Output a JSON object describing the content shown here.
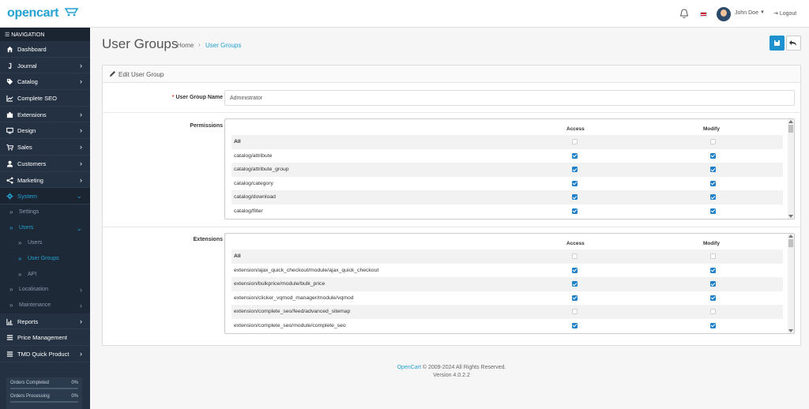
{
  "header": {
    "logo": "opencart",
    "user_name": "John Doe",
    "logout_label": "Logout"
  },
  "sidebar": {
    "nav_header": "NAVIGATION",
    "items": [
      {
        "label": "Dashboard",
        "icon": "home-icon",
        "has_children": false
      },
      {
        "label": "Journal",
        "icon": "journal-icon",
        "has_children": true
      },
      {
        "label": "Catalog",
        "icon": "tag-icon",
        "has_children": true
      },
      {
        "label": "Complete SEO",
        "icon": "chart-line-icon",
        "has_children": false
      },
      {
        "label": "Extensions",
        "icon": "puzzle-icon",
        "has_children": true
      },
      {
        "label": "Design",
        "icon": "monitor-icon",
        "has_children": true
      },
      {
        "label": "Sales",
        "icon": "cart-icon",
        "has_children": true
      },
      {
        "label": "Customers",
        "icon": "user-icon",
        "has_children": true
      },
      {
        "label": "Marketing",
        "icon": "share-icon",
        "has_children": true
      },
      {
        "label": "System",
        "icon": "gear-icon",
        "has_children": true,
        "active": true
      }
    ],
    "system_sub": {
      "settings": "Settings",
      "users": "Users",
      "users_sub": [
        "Users",
        "User Groups",
        "API"
      ],
      "localisation": "Localisation",
      "maintenance": "Maintenance"
    },
    "after_items": [
      {
        "label": "Reports",
        "icon": "bar-chart-icon",
        "has_children": true
      },
      {
        "label": "Price Management",
        "icon": "list-icon",
        "has_children": false
      },
      {
        "label": "TMD Quick Product",
        "icon": "list-icon",
        "has_children": true
      }
    ],
    "stats": [
      {
        "label": "Orders Completed",
        "pct": "0%"
      },
      {
        "label": "Orders Processing",
        "pct": "0%"
      }
    ]
  },
  "page": {
    "title": "User Groups",
    "breadcrumb_home": "Home",
    "breadcrumb_current": "User Groups"
  },
  "panel": {
    "title": "Edit User Group",
    "name_label": "User Group Name",
    "name_value": "Administrator",
    "permissions_label": "Permissions",
    "extensions_label": "Extensions",
    "col_access": "Access",
    "col_modify": "Modify",
    "all_label": "All",
    "permissions_rows": [
      {
        "route": "catalog/attribute",
        "access": true,
        "modify": true
      },
      {
        "route": "catalog/attribute_group",
        "access": true,
        "modify": true
      },
      {
        "route": "catalog/category",
        "access": true,
        "modify": true
      },
      {
        "route": "catalog/download",
        "access": true,
        "modify": true
      },
      {
        "route": "catalog/filter",
        "access": true,
        "modify": true
      }
    ],
    "extensions_rows": [
      {
        "route": "extension/ajax_quick_checkout/module/ajax_quick_checkout",
        "access": true,
        "modify": true
      },
      {
        "route": "extension/bulkprice/module/bulk_price",
        "access": true,
        "modify": true
      },
      {
        "route": "extension/clicker_vqmod_manager/module/vqmod",
        "access": true,
        "modify": true
      },
      {
        "route": "extension/complete_seo/feed/advanced_sitemap",
        "access": false,
        "modify": false
      },
      {
        "route": "extension/complete_seo/module/complete_seo",
        "access": true,
        "modify": true
      }
    ]
  },
  "footer": {
    "brand": "OpenCart",
    "copyright": " © 2009-2024 All Rights Reserved.",
    "version": "Version 4.0.2.2"
  }
}
